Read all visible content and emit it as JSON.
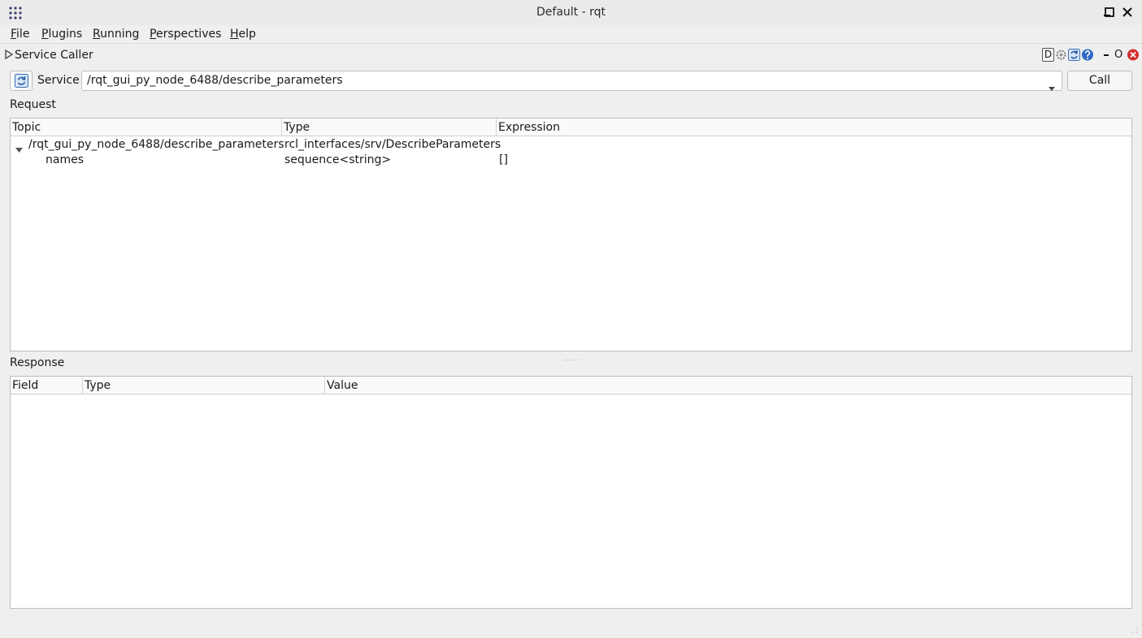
{
  "window": {
    "title": "Default - rqt",
    "icons": {
      "app": "app-grid-icon",
      "minimize": "minimize-icon",
      "maximize": "maximize-icon",
      "close": "close-icon"
    }
  },
  "menu": [
    {
      "mnemonic": "F",
      "rest": "ile"
    },
    {
      "mnemonic": "P",
      "rest": "lugins"
    },
    {
      "mnemonic": "R",
      "rest": "unning"
    },
    {
      "mnemonic": "P",
      "rest": "erspectives"
    },
    {
      "mnemonic": "H",
      "rest": "elp"
    }
  ],
  "dock": {
    "title": "Service Caller",
    "d_label": "D",
    "float_label": "O",
    "icons": [
      "expand-arrow-icon",
      "gear-icon",
      "reload-icon",
      "help-icon",
      "minimize-icon",
      "close-icon"
    ]
  },
  "service": {
    "label": "Service",
    "selected": "/rqt_gui_py_node_6488/describe_parameters",
    "call_label": "Call"
  },
  "request": {
    "label": "Request",
    "headers": [
      "Topic",
      "Type",
      "Expression"
    ],
    "rows": [
      {
        "topic": "/rqt_gui_py_node_6488/describe_parameters",
        "type": "rcl_interfaces/srv/DescribeParameters",
        "expression": "",
        "expanded": true
      },
      {
        "topic": "names",
        "type": "sequence<string>",
        "expression": "[]"
      }
    ]
  },
  "response": {
    "label": "Response",
    "headers": [
      "Field",
      "Type",
      "Value"
    ]
  }
}
